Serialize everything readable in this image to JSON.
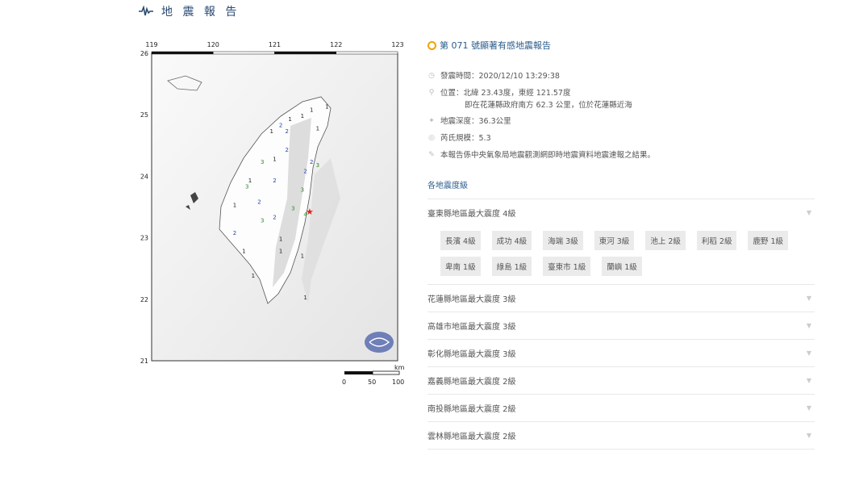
{
  "header": {
    "title": "地 震 報 告"
  },
  "report": {
    "title": "第 071 號顯著有感地震報告"
  },
  "info": {
    "time": "發震時間：2020/12/10 13:29:38",
    "location": "位置：北緯 23.43度，東經 121.57度",
    "location_detail": "即在花蓮縣政府南方 62.3 公里，位於花蓮縣近海",
    "depth": "地震深度：36.3公里",
    "magnitude": "芮氏規模：5.3",
    "note": "本報告係中央氣象局地震觀測網即時地震資料地震速報之結果。"
  },
  "intensity": {
    "title": "各地震度級",
    "regions": [
      {
        "label": "臺東縣地區最大震度 4級",
        "expanded": true,
        "stations": [
          "長濱 4級",
          "成功 4級",
          "海端 3級",
          "東河 3級",
          "池上 2級",
          "利稻 2級",
          "鹿野 1級",
          "卑南 1級",
          "綠島 1級",
          "臺東市 1級",
          "蘭嶼 1級"
        ]
      },
      {
        "label": "花蓮縣地區最大震度 3級"
      },
      {
        "label": "高雄市地區最大震度 3級"
      },
      {
        "label": "彰化縣地區最大震度 3級"
      },
      {
        "label": "嘉義縣地區最大震度 2級"
      },
      {
        "label": "南投縣地區最大震度 2級"
      },
      {
        "label": "雲林縣地區最大震度 2級"
      }
    ]
  },
  "map": {
    "lon_ticks": [
      "119",
      "120",
      "121",
      "122",
      "123"
    ],
    "lat_ticks": [
      "26",
      "25",
      "24",
      "23",
      "22",
      "21"
    ],
    "scale_unit": "km",
    "scale_labels": [
      "0",
      "50",
      "100"
    ],
    "markers": [
      {
        "v": "1",
        "lon": 121.85,
        "lat": 25.1,
        "c": "#222"
      },
      {
        "v": "1",
        "lon": 121.6,
        "lat": 25.05,
        "c": "#222"
      },
      {
        "v": "1",
        "lon": 121.45,
        "lat": 24.95,
        "c": "#222"
      },
      {
        "v": "1",
        "lon": 121.25,
        "lat": 24.9,
        "c": "#222"
      },
      {
        "v": "2",
        "lon": 121.1,
        "lat": 24.8,
        "c": "#2244aa"
      },
      {
        "v": "1",
        "lon": 120.95,
        "lat": 24.7,
        "c": "#222"
      },
      {
        "v": "2",
        "lon": 121.2,
        "lat": 24.7,
        "c": "#2244aa"
      },
      {
        "v": "1",
        "lon": 121.7,
        "lat": 24.75,
        "c": "#222"
      },
      {
        "v": "2",
        "lon": 121.2,
        "lat": 24.4,
        "c": "#2244aa"
      },
      {
        "v": "3",
        "lon": 120.8,
        "lat": 24.2,
        "c": "#2a8a2a"
      },
      {
        "v": "1",
        "lon": 121.0,
        "lat": 24.25,
        "c": "#222"
      },
      {
        "v": "2",
        "lon": 121.6,
        "lat": 24.2,
        "c": "#2244aa"
      },
      {
        "v": "3",
        "lon": 121.7,
        "lat": 24.15,
        "c": "#2a8a2a"
      },
      {
        "v": "2",
        "lon": 121.5,
        "lat": 24.05,
        "c": "#2244aa"
      },
      {
        "v": "1",
        "lon": 120.6,
        "lat": 23.9,
        "c": "#222"
      },
      {
        "v": "3",
        "lon": 120.55,
        "lat": 23.8,
        "c": "#2a8a2a"
      },
      {
        "v": "2",
        "lon": 121.0,
        "lat": 23.9,
        "c": "#2244aa"
      },
      {
        "v": "3",
        "lon": 121.45,
        "lat": 23.75,
        "c": "#2a8a2a"
      },
      {
        "v": "2",
        "lon": 120.75,
        "lat": 23.55,
        "c": "#2244aa"
      },
      {
        "v": "1",
        "lon": 120.35,
        "lat": 23.5,
        "c": "#222"
      },
      {
        "v": "3",
        "lon": 121.3,
        "lat": 23.45,
        "c": "#2a8a2a"
      },
      {
        "v": "4",
        "lon": 121.5,
        "lat": 23.35,
        "c": "#2a8a2a"
      },
      {
        "v": "2",
        "lon": 121.0,
        "lat": 23.3,
        "c": "#2244aa"
      },
      {
        "v": "3",
        "lon": 120.8,
        "lat": 23.25,
        "c": "#2a8a2a"
      },
      {
        "v": "2",
        "lon": 120.35,
        "lat": 23.05,
        "c": "#2244aa"
      },
      {
        "v": "1",
        "lon": 121.1,
        "lat": 22.95,
        "c": "#222"
      },
      {
        "v": "1",
        "lon": 120.5,
        "lat": 22.75,
        "c": "#222"
      },
      {
        "v": "1",
        "lon": 121.1,
        "lat": 22.75,
        "c": "#222"
      },
      {
        "v": "1",
        "lon": 121.45,
        "lat": 22.67,
        "c": "#222"
      },
      {
        "v": "1",
        "lon": 120.65,
        "lat": 22.35,
        "c": "#222"
      },
      {
        "v": "1",
        "lon": 121.5,
        "lat": 22.0,
        "c": "#222"
      }
    ],
    "epicenter": {
      "lon": 121.57,
      "lat": 23.43,
      "c": "#e02020"
    }
  }
}
